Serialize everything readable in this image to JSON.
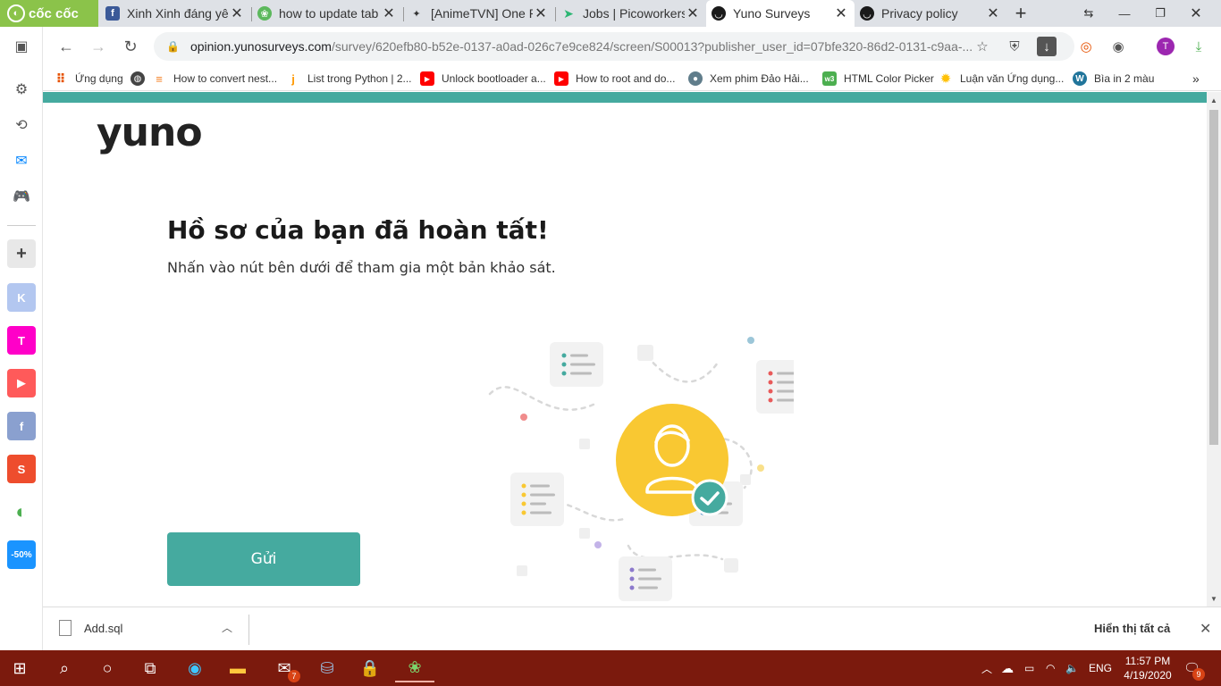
{
  "browser": {
    "brand": "cốc cốc",
    "tabs": [
      {
        "title": "Xinh Xinh đáng yê",
        "favicon": "facebook-icon",
        "color": "#3b5998"
      },
      {
        "title": "how to update tab",
        "favicon": "coccoc-leaf-icon",
        "color": "#5cb85c"
      },
      {
        "title": "[AnimeTVN] One P",
        "favicon": "anime-icon",
        "color": "#333333"
      },
      {
        "title": "Jobs | Picoworkers",
        "favicon": "picoworkers-icon",
        "color": "#2bb673"
      },
      {
        "title": "Yuno Surveys",
        "favicon": "yuno-icon",
        "color": "#1a1a1a",
        "active": true
      },
      {
        "title": "Privacy policy",
        "favicon": "yuno-icon",
        "color": "#1a1a1a"
      }
    ],
    "url_host": "opinion.yunosurveys.com",
    "url_path": "/survey/620efb80-b52e-0137-a0ad-026c7e9ce824/screen/S00013?publisher_user_id=07bfe320-86d2-0131-c9aa-...",
    "avatar_letter": "T"
  },
  "bookmarks": [
    {
      "label": "Ứng dụng",
      "icon": "apps-grid-icon",
      "color": "#e65100"
    },
    {
      "label": "",
      "icon": "globe-icon",
      "color": "#444444"
    },
    {
      "label": "How to convert nest...",
      "icon": "stackoverflow-icon",
      "color": "#f48024"
    },
    {
      "label": "List trong Python | 2...",
      "icon": "j-icon",
      "color": "#ff9800"
    },
    {
      "label": "Unlock bootloader a...",
      "icon": "youtube-icon",
      "color": "#ff0000"
    },
    {
      "label": "How to root and do...",
      "icon": "youtube-icon",
      "color": "#ff0000"
    },
    {
      "label": "Xem phim Đảo Hải...",
      "icon": "film-icon",
      "color": "#607d8b"
    },
    {
      "label": "HTML Color Picker",
      "icon": "w3-icon",
      "color": "#4caf50"
    },
    {
      "label": "Luận văn Ứng dụng...",
      "icon": "sun-icon",
      "color": "#ffc107"
    },
    {
      "label": "Bìa in 2 màu",
      "icon": "wordpress-icon",
      "color": "#21759b"
    }
  ],
  "sidepanel": {
    "apps": [
      {
        "name": "k-app",
        "label": "K",
        "color": "#b3c7f0"
      },
      {
        "name": "t-app",
        "label": "T",
        "color": "#ff00c8"
      },
      {
        "name": "youtube-app",
        "label": "▶",
        "color": "#ff5a5a"
      },
      {
        "name": "facebook-app",
        "label": "f",
        "color": "#8aa0cf"
      },
      {
        "name": "shopee-app",
        "label": "S",
        "color": "#ee4d2d"
      },
      {
        "name": "coccoc-app",
        "label": "◐",
        "color": "#ffffff"
      },
      {
        "name": "tiki-app",
        "label": "-50%",
        "color": "#1a94ff"
      }
    ]
  },
  "page": {
    "logo": "yuno",
    "headline": "Hồ sơ của bạn đã hoàn tất!",
    "subline": "Nhấn vào nút bên dưới để tham gia một bản khảo sát.",
    "submit_label": "Gửi",
    "accent": "#45aa9f",
    "illustration_color": "#f9c832"
  },
  "downloads": {
    "file_name": "Add.sql",
    "show_all": "Hiển thị tất cả"
  },
  "taskbar": {
    "language": "ENG",
    "time": "11:57 PM",
    "date": "4/19/2020",
    "mail_badge": "7",
    "notify_badge": "9"
  }
}
